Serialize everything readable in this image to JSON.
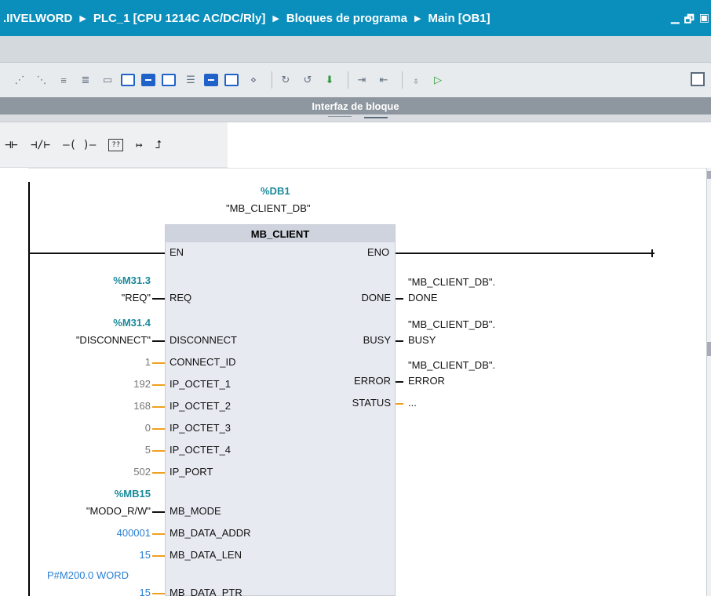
{
  "titlebar": {
    "crumbs": [
      ".IIVELWORD",
      "PLC_1 [CPU 1214C AC/DC/Rly]",
      "Bloques de programa",
      "Main [OB1]"
    ],
    "sep_glyph": "▶",
    "controls": [
      "▁",
      "🗗",
      "▣"
    ]
  },
  "toolbar": {
    "icons": [
      "connect-icon",
      "disconnect-icon",
      "insert-network-icon",
      "delete-network-icon",
      "network-icon",
      "block-list-icon",
      "list-view-icon",
      "comment-icon",
      "absolute-address-icon",
      "favorites-icon",
      "list-icon",
      "monitoring-icon",
      "go-online-icon",
      "go-offline-icon",
      "status-icon",
      "indent-icon",
      "outdent-icon",
      "observe-icon",
      "callstack-icon"
    ]
  },
  "interfaz": {
    "label": "Interfaz de bloque"
  },
  "ladder_elements": [
    {
      "name": "no-contact-icon",
      "glyph": "⊣⊢"
    },
    {
      "name": "nc-contact-icon",
      "glyph": "⊣/⊢"
    },
    {
      "name": "coil-icon",
      "glyph": "—( )—"
    },
    {
      "name": "empty-box-icon",
      "glyph": "??"
    },
    {
      "name": "open-branch-icon",
      "glyph": "↦"
    },
    {
      "name": "close-branch-icon",
      "glyph": "⮥"
    }
  ],
  "block": {
    "db_address": "%DB1",
    "db_name": "\"MB_CLIENT_DB\"",
    "type": "MB_CLIENT",
    "en": "EN",
    "eno": "ENO",
    "inputs": [
      {
        "pin": "REQ",
        "addr": "%M31.3",
        "tag": "\"REQ\"",
        "value": "",
        "style": "tag"
      },
      {
        "pin": "DISCONNECT",
        "addr": "%M31.4",
        "tag": "\"DISCONNECT\"",
        "value": "",
        "style": "tag"
      },
      {
        "pin": "CONNECT_ID",
        "value": "1",
        "style": "const"
      },
      {
        "pin": "IP_OCTET_1",
        "value": "192",
        "style": "const"
      },
      {
        "pin": "IP_OCTET_2",
        "value": "168",
        "style": "const"
      },
      {
        "pin": "IP_OCTET_3",
        "value": "0",
        "style": "const"
      },
      {
        "pin": "IP_OCTET_4",
        "value": "5",
        "style": "const"
      },
      {
        "pin": "IP_PORT",
        "value": "502",
        "style": "const"
      },
      {
        "pin": "MB_MODE",
        "addr": "%MB15",
        "tag": "\"MODO_R/W\"",
        "value": "",
        "style": "tag"
      },
      {
        "pin": "MB_DATA_ADDR",
        "value": "400001",
        "style": "blue"
      },
      {
        "pin": "MB_DATA_LEN",
        "value": "15",
        "style": "blue"
      },
      {
        "pin": "MB_DATA_PTR",
        "addr": "P#M200.0 WORD",
        "value": "15",
        "style": "ptr"
      }
    ],
    "outputs": [
      {
        "pin": "DONE",
        "tag1": "\"MB_CLIENT_DB\".",
        "tag2": "DONE"
      },
      {
        "pin": "BUSY",
        "tag1": "\"MB_CLIENT_DB\".",
        "tag2": "BUSY"
      },
      {
        "pin": "ERROR",
        "tag1": "\"MB_CLIENT_DB\".",
        "tag2": "ERROR"
      },
      {
        "pin": "STATUS",
        "tag1": "",
        "tag2": "..."
      }
    ]
  }
}
